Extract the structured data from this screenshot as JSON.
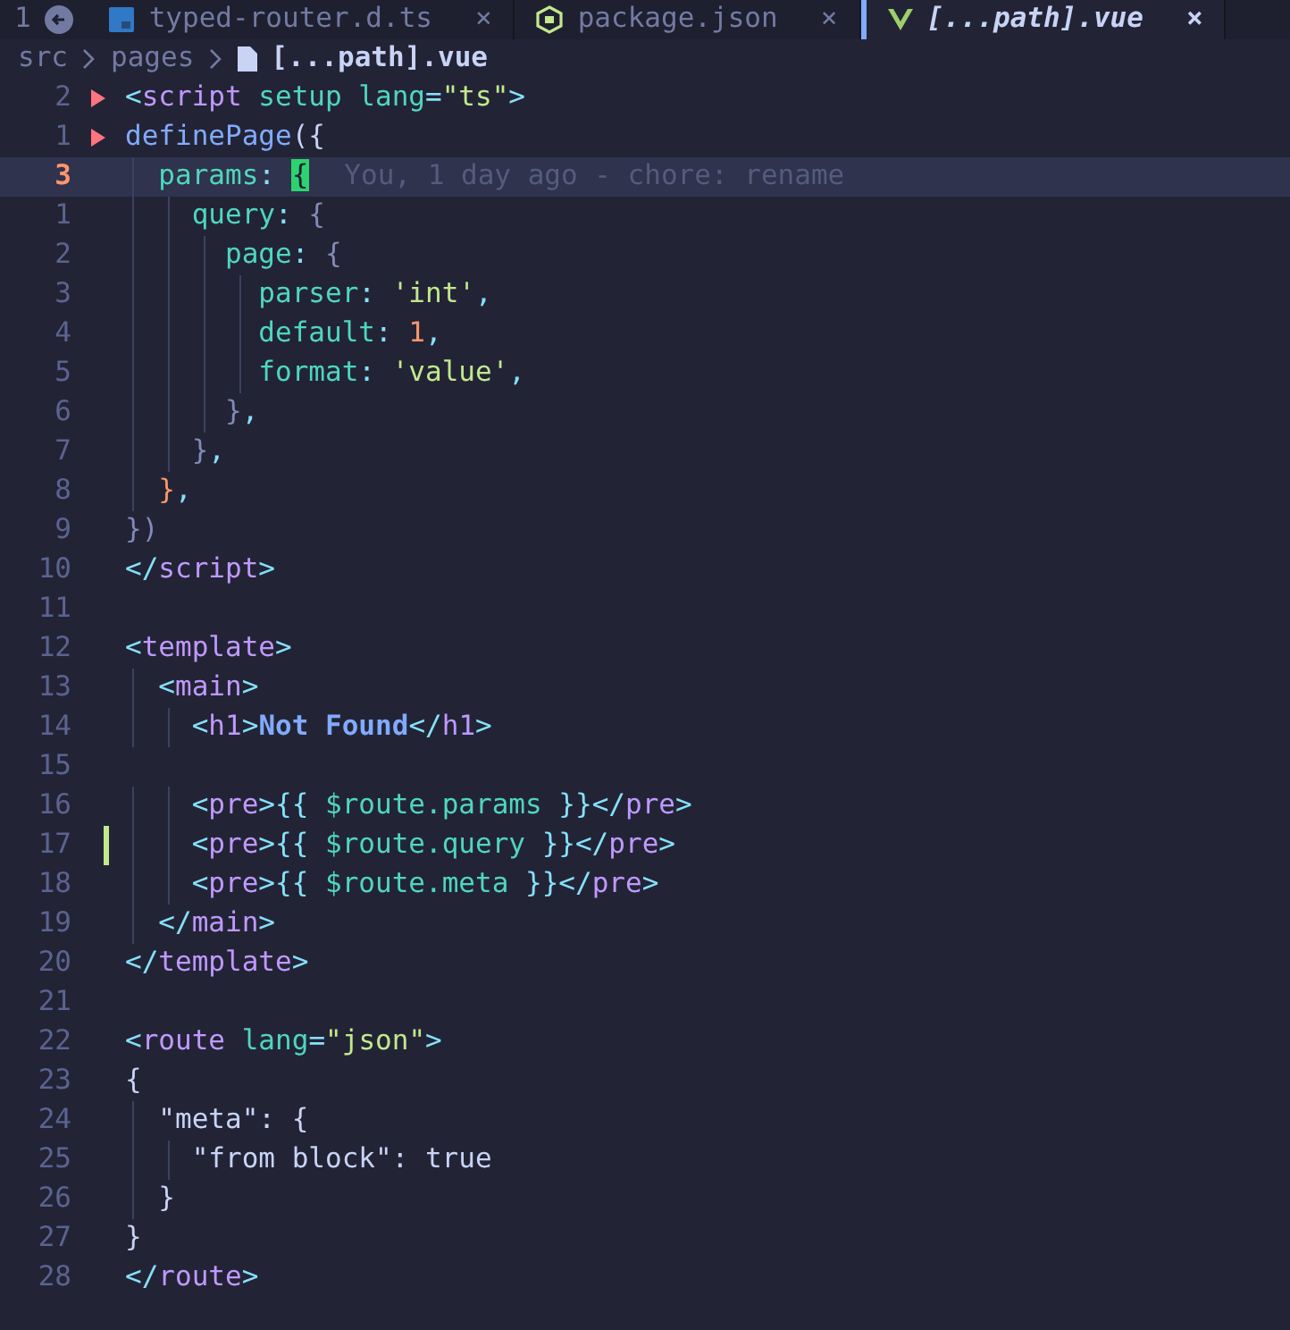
{
  "tab_bar": {
    "group_number": "1",
    "tabs": [
      {
        "label": "typed-router.d.ts",
        "kind": "ts",
        "selected": false,
        "close": "×"
      },
      {
        "label": "package.json",
        "kind": "node",
        "selected": false,
        "close": "×"
      },
      {
        "label": "[...path].vue",
        "kind": "vue",
        "selected": true,
        "close": "×"
      }
    ]
  },
  "breadcrumb": [
    "src",
    "pages",
    "[...path].vue"
  ],
  "editor": {
    "lines": [
      {
        "number": "2",
        "current": false,
        "fold": true,
        "tokens": [
          {
            "text": "<",
            "kind": "punct"
          },
          {
            "text": "script",
            "kind": "tag"
          },
          {
            "text": " setup lang",
            "kind": "attr"
          },
          {
            "text": "=",
            "kind": "punct"
          },
          {
            "text": "\"ts\"",
            "kind": "string"
          },
          {
            "text": ">",
            "kind": "punct"
          }
        ]
      },
      {
        "number": "1",
        "current": false,
        "fold": true,
        "tokens": [
          {
            "text": "definePage",
            "kind": "func"
          },
          {
            "text": "({",
            "kind": "text"
          }
        ]
      },
      {
        "number": "3",
        "current": true,
        "blame": "You, 1 day ago - chore: rename",
        "tokens": [
          {
            "text": "  params",
            "kind": "key"
          },
          {
            "text": ": ",
            "kind": "punct"
          },
          {
            "text": "{",
            "kind": "cursor"
          }
        ]
      },
      {
        "number": "1",
        "current": false,
        "tokens": [
          {
            "text": "    query",
            "kind": "key"
          },
          {
            "text": ": ",
            "kind": "punct"
          },
          {
            "text": "{",
            "kind": "brace"
          }
        ]
      },
      {
        "number": "2",
        "current": false,
        "tokens": [
          {
            "text": "      page",
            "kind": "key"
          },
          {
            "text": ": ",
            "kind": "punct"
          },
          {
            "text": "{",
            "kind": "brace"
          }
        ]
      },
      {
        "number": "3",
        "current": false,
        "tokens": [
          {
            "text": "        parser",
            "kind": "key"
          },
          {
            "text": ": ",
            "kind": "punct"
          },
          {
            "text": "'int'",
            "kind": "string"
          },
          {
            "text": ",",
            "kind": "punct"
          }
        ]
      },
      {
        "number": "4",
        "current": false,
        "tokens": [
          {
            "text": "        default",
            "kind": "key"
          },
          {
            "text": ": ",
            "kind": "punct"
          },
          {
            "text": "1",
            "kind": "number"
          },
          {
            "text": ",",
            "kind": "punct"
          }
        ]
      },
      {
        "number": "5",
        "current": false,
        "tokens": [
          {
            "text": "        format",
            "kind": "key"
          },
          {
            "text": ": ",
            "kind": "punct"
          },
          {
            "text": "'value'",
            "kind": "string"
          },
          {
            "text": ",",
            "kind": "punct"
          }
        ]
      },
      {
        "number": "6",
        "current": false,
        "tokens": [
          {
            "text": "      }",
            "kind": "brace"
          },
          {
            "text": ",",
            "kind": "punct"
          }
        ]
      },
      {
        "number": "7",
        "current": false,
        "tokens": [
          {
            "text": "    }",
            "kind": "brace"
          },
          {
            "text": ",",
            "kind": "punct"
          }
        ]
      },
      {
        "number": "8",
        "current": false,
        "tokens": [
          {
            "text": "  }",
            "kind": "match"
          },
          {
            "text": ",",
            "kind": "punct"
          }
        ]
      },
      {
        "number": "9",
        "current": false,
        "tokens": [
          {
            "text": "})",
            "kind": "brace"
          }
        ]
      },
      {
        "number": "10",
        "current": false,
        "tokens": [
          {
            "text": "</",
            "kind": "punct"
          },
          {
            "text": "script",
            "kind": "tag"
          },
          {
            "text": ">",
            "kind": "punct"
          }
        ]
      },
      {
        "number": "11",
        "current": false
      },
      {
        "number": "12",
        "current": false,
        "tokens": [
          {
            "text": "<",
            "kind": "punct"
          },
          {
            "text": "template",
            "kind": "tag"
          },
          {
            "text": ">",
            "kind": "punct"
          }
        ]
      },
      {
        "number": "13",
        "current": false,
        "tokens": [
          {
            "text": "  <",
            "kind": "punct"
          },
          {
            "text": "main",
            "kind": "tag"
          },
          {
            "text": ">",
            "kind": "punct"
          }
        ]
      },
      {
        "number": "14",
        "current": false,
        "tokens": [
          {
            "text": "    <",
            "kind": "punct"
          },
          {
            "text": "h1",
            "kind": "tag"
          },
          {
            "text": ">",
            "kind": "punct"
          },
          {
            "text": "Not Found",
            "kind": "heading"
          },
          {
            "text": "</",
            "kind": "punct"
          },
          {
            "text": "h1",
            "kind": "tag"
          },
          {
            "text": ">",
            "kind": "punct"
          }
        ]
      },
      {
        "number": "15",
        "current": false
      },
      {
        "number": "16",
        "current": false,
        "tokens": [
          {
            "text": "    <",
            "kind": "punct"
          },
          {
            "text": "pre",
            "kind": "tag"
          },
          {
            "text": ">{{ ",
            "kind": "punct"
          },
          {
            "text": "$route.params",
            "kind": "attr"
          },
          {
            "text": " }}</",
            "kind": "punct"
          },
          {
            "text": "pre",
            "kind": "tag"
          },
          {
            "text": ">",
            "kind": "punct"
          }
        ]
      },
      {
        "number": "17",
        "current": false,
        "changed": true,
        "tokens": [
          {
            "text": "    <",
            "kind": "punct"
          },
          {
            "text": "pre",
            "kind": "tag"
          },
          {
            "text": ">{{ ",
            "kind": "punct"
          },
          {
            "text": "$route.query",
            "kind": "attr"
          },
          {
            "text": " }}</",
            "kind": "punct"
          },
          {
            "text": "pre",
            "kind": "tag"
          },
          {
            "text": ">",
            "kind": "punct"
          }
        ]
      },
      {
        "number": "18",
        "current": false,
        "tokens": [
          {
            "text": "    <",
            "kind": "punct"
          },
          {
            "text": "pre",
            "kind": "tag"
          },
          {
            "text": ">{{ ",
            "kind": "punct"
          },
          {
            "text": "$route.meta",
            "kind": "attr"
          },
          {
            "text": " }}</",
            "kind": "punct"
          },
          {
            "text": "pre",
            "kind": "tag"
          },
          {
            "text": ">",
            "kind": "punct"
          }
        ]
      },
      {
        "number": "19",
        "current": false,
        "tokens": [
          {
            "text": "  </",
            "kind": "punct"
          },
          {
            "text": "main",
            "kind": "tag"
          },
          {
            "text": ">",
            "kind": "punct"
          }
        ]
      },
      {
        "number": "20",
        "current": false,
        "tokens": [
          {
            "text": "</",
            "kind": "punct"
          },
          {
            "text": "template",
            "kind": "tag"
          },
          {
            "text": ">",
            "kind": "punct"
          }
        ]
      },
      {
        "number": "21",
        "current": false
      },
      {
        "number": "22",
        "current": false,
        "tokens": [
          {
            "text": "<",
            "kind": "punct"
          },
          {
            "text": "route",
            "kind": "tag"
          },
          {
            "text": " lang",
            "kind": "attr"
          },
          {
            "text": "=",
            "kind": "punct"
          },
          {
            "text": "\"json\"",
            "kind": "string"
          },
          {
            "text": ">",
            "kind": "punct"
          }
        ]
      },
      {
        "number": "23",
        "current": false,
        "tokens": [
          {
            "text": "{",
            "kind": "text"
          }
        ]
      },
      {
        "number": "24",
        "current": false,
        "tokens": [
          {
            "text": "  \"meta\": {",
            "kind": "text"
          }
        ]
      },
      {
        "number": "25",
        "current": false,
        "tokens": [
          {
            "text": "    \"from block\": true",
            "kind": "text"
          }
        ]
      },
      {
        "number": "26",
        "current": false,
        "tokens": [
          {
            "text": "  }",
            "kind": "text"
          }
        ]
      },
      {
        "number": "27",
        "current": false,
        "tokens": [
          {
            "text": "}",
            "kind": "text"
          }
        ]
      },
      {
        "number": "28",
        "current": false,
        "tokens": [
          {
            "text": "</",
            "kind": "punct"
          },
          {
            "text": "route",
            "kind": "tag"
          },
          {
            "text": ">",
            "kind": "punct"
          }
        ]
      }
    ]
  }
}
